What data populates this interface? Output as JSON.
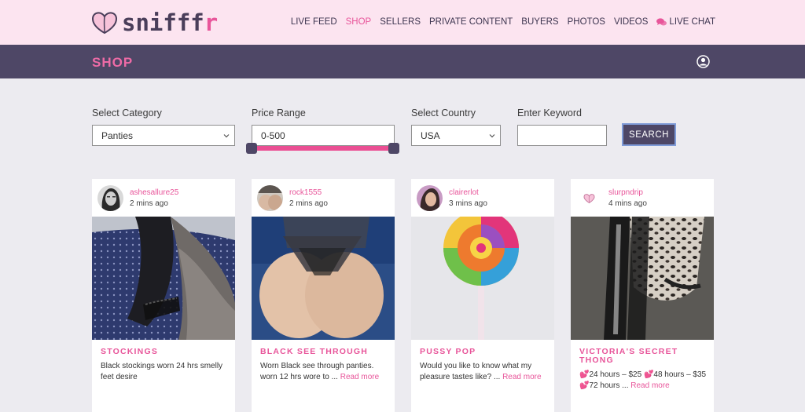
{
  "brand": {
    "name_main": "snifff",
    "name_accent": "r"
  },
  "nav": {
    "items": [
      "LIVE FEED",
      "SHOP",
      "SELLERS",
      "PRIVATE CONTENT",
      "BUYERS",
      "PHOTOS",
      "VIDEOS"
    ],
    "active": "SHOP",
    "chat_label": "LIVE CHAT"
  },
  "section": {
    "title": "SHOP"
  },
  "filters": {
    "category_label": "Select Category",
    "category_value": "Panties",
    "price_label": "Price Range",
    "price_value": "0-500",
    "country_label": "Select Country",
    "country_value": "USA",
    "keyword_label": "Enter Keyword",
    "keyword_value": "",
    "search_label": "SEARCH"
  },
  "cards": [
    {
      "user": "ashesallure25",
      "time": "2 mins ago",
      "title": "STOCKINGS",
      "desc": "Black stockings worn 24 hrs smelly feet desire",
      "more": ""
    },
    {
      "user": "rock1555",
      "time": "2 mins ago",
      "title": "BLACK SEE THROUGH",
      "desc": "Worn Black see through panties. worn 12 hrs wore to  ...",
      "more": "Read more"
    },
    {
      "user": "clairerlot",
      "time": "3 mins ago",
      "title": "PUSSY POP",
      "desc": "Would you like to know what my pleasure tastes like?  ...",
      "more": "Read more"
    },
    {
      "user": "slurpndrip",
      "time": "4 mins ago",
      "title": "VICTORIA'S SECRET THONG",
      "desc": "💕24 hours – $25 💕48 hours – $35 💕72 hours  ...",
      "more": "Read more"
    }
  ],
  "colors": {
    "brand_pink": "#e8559a",
    "header_bg": "#fce4f0",
    "section_bg": "#4e4766",
    "page_bg": "#ecebf0"
  }
}
